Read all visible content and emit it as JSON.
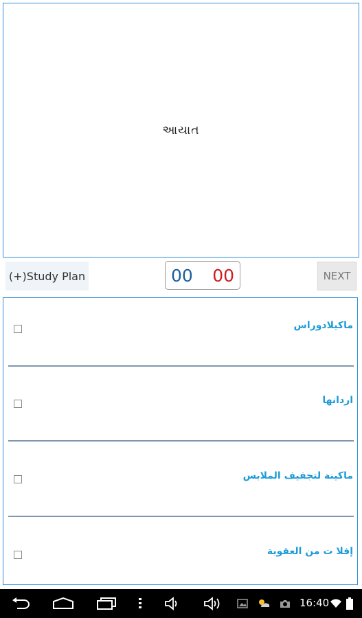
{
  "question": {
    "text": "આયાત"
  },
  "controls": {
    "study_plan_label": "(+)Study Plan",
    "timer_minutes": "00",
    "timer_seconds": "00",
    "next_label": "NEXT"
  },
  "options": [
    {
      "label": "ماكيلادوراس",
      "checked": false
    },
    {
      "label": "اردانها",
      "checked": false
    },
    {
      "label": "ماكينة لتجفيف الملابس",
      "checked": false
    },
    {
      "label": "إفلا ت من العقوبة",
      "checked": false
    }
  ],
  "status_bar": {
    "time": "16:40",
    "icons": [
      "back-icon",
      "home-icon",
      "recent-apps-icon",
      "menu-icon",
      "volume-down-icon",
      "volume-up-icon",
      "gallery-icon",
      "weather-icon",
      "camera-icon",
      "wifi-icon",
      "battery-icon"
    ]
  },
  "colors": {
    "accent": "#2f8fd8",
    "option_text": "#1e9bd7",
    "timer_minutes": "#1a5f9c",
    "timer_seconds": "#cc1f1f",
    "divider": "#7f96ad"
  }
}
